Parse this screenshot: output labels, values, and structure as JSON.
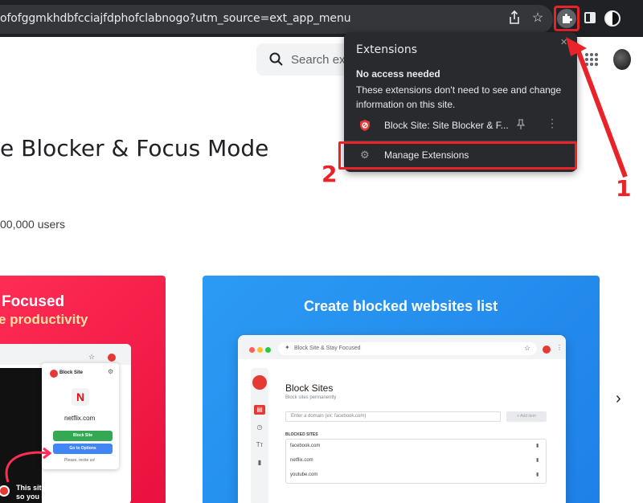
{
  "browser": {
    "url": "ofofggmkhdbfcciajfdphofclabnogo?utm_source=ext_app_menu",
    "icons": [
      "share-icon",
      "star-icon",
      "extensions-icon",
      "side-panel-icon",
      "profile-icon"
    ]
  },
  "page": {
    "search_placeholder": "Search ex",
    "title": "e Blocker & Focus Mode",
    "users": "00,000 users",
    "promo_red": {
      "heading": "Focused",
      "subheading": "e productivity",
      "popup_title": "Block Site",
      "site": "netflix.com",
      "logo_letter": "N",
      "primary_btn": "Block Site",
      "secondary_btn": "Go to Options",
      "footer": "Please, recite us!",
      "caption_line1": "This site is blocked",
      "caption_line2": "so you can focuson your work"
    },
    "promo_blue": {
      "heading": "Create blocked websites list",
      "mock_url": "Block Site & Stay Focused",
      "panel_title": "Block Sites",
      "panel_sub": "Block sites permanently",
      "input_placeholder": "Enter a domain (ex: facebook.com)",
      "add_button": "+ Add item",
      "list_label": "BLOCKED SITES",
      "sites": [
        "facebook.com",
        "netflix.com",
        "youtube.com"
      ]
    }
  },
  "extensions_menu": {
    "title": "Extensions",
    "section": "No access needed",
    "description": "These extensions don't need to see and change information on this site.",
    "extension_name": "Block Site: Site Blocker & F...",
    "manage_label": "Manage Extensions"
  },
  "annotations": {
    "step1": "1",
    "step2": "2",
    "color": "#e8242a"
  }
}
